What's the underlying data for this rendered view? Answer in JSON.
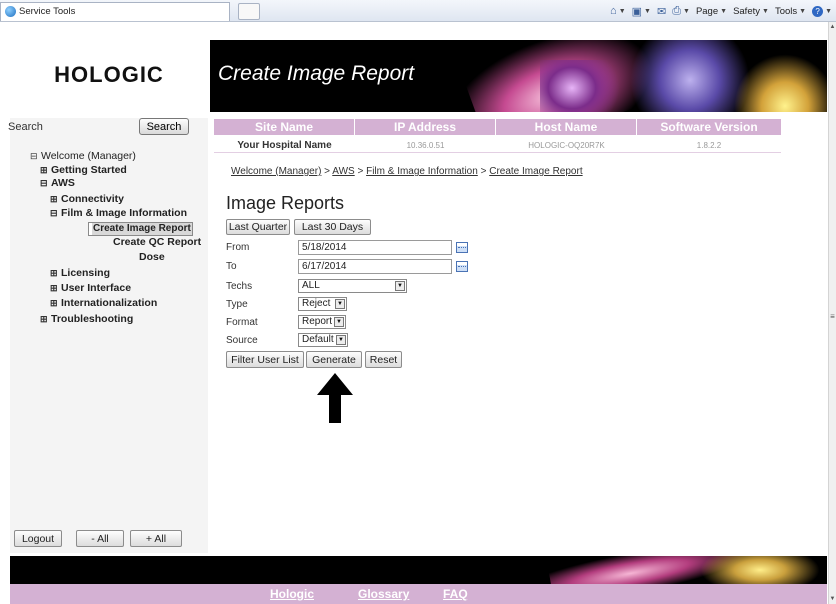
{
  "browser": {
    "tab_title": "Service Tools",
    "commands": [
      {
        "icon": "home-icon",
        "label": ""
      },
      {
        "icon": "feeds-icon",
        "label": ""
      },
      {
        "icon": "mail-icon",
        "label": ""
      },
      {
        "icon": "print-icon",
        "label": ""
      },
      {
        "icon": "",
        "label": "Page"
      },
      {
        "icon": "",
        "label": "Safety"
      },
      {
        "icon": "",
        "label": "Tools"
      },
      {
        "icon": "help-icon",
        "label": ""
      }
    ]
  },
  "header": {
    "logo": "HOLOGIC",
    "title": "Create Image Report"
  },
  "search": {
    "label": "Search",
    "button": "Search"
  },
  "nav": {
    "welcome": "Welcome (Manager)",
    "getting_started": "Getting Started",
    "aws": "AWS",
    "connectivity": "Connectivity",
    "film_image": "Film & Image Information",
    "create_image_report": "Create Image Report",
    "create_qc_report": "Create QC Report",
    "dose": "Dose",
    "licensing": "Licensing",
    "user_interface": "User Interface",
    "internationalization": "Internationalization",
    "troubleshooting": "Troubleshooting",
    "expand_symbol": "⊞",
    "collapse_symbol": "⊟"
  },
  "bottom_buttons": {
    "logout": "Logout",
    "minus_all": "- All",
    "plus_all": "+ All"
  },
  "info": {
    "headers": [
      "Site Name",
      "IP Address",
      "Host Name",
      "Software Version"
    ],
    "site_name": "Your Hospital Name",
    "ip_address": "10.36.0.51",
    "host_name": "HOLOGIC-OQ20R7K",
    "software_version": "1.8.2.2"
  },
  "breadcrumb": {
    "items": [
      "Welcome (Manager)",
      "AWS",
      "Film & Image Information",
      "Create Image Report"
    ],
    "sep": " > "
  },
  "form": {
    "heading": "Image Reports",
    "last_quarter": "Last Quarter",
    "last_30_days": "Last 30 Days",
    "from_label": "From",
    "from_value": "5/18/2014",
    "to_label": "To",
    "to_value": "6/17/2014",
    "techs_label": "Techs",
    "techs_value": "ALL",
    "type_label": "Type",
    "type_value": "Reject",
    "format_label": "Format",
    "format_value": "Report",
    "source_label": "Source",
    "source_value": "Default",
    "filter_user_list": "Filter User List",
    "generate": "Generate",
    "reset": "Reset"
  },
  "footer": {
    "links": [
      "Hologic",
      "Glossary",
      "FAQ"
    ]
  },
  "colors": {
    "accent": "#d4b1d3",
    "banner": "#000000"
  }
}
